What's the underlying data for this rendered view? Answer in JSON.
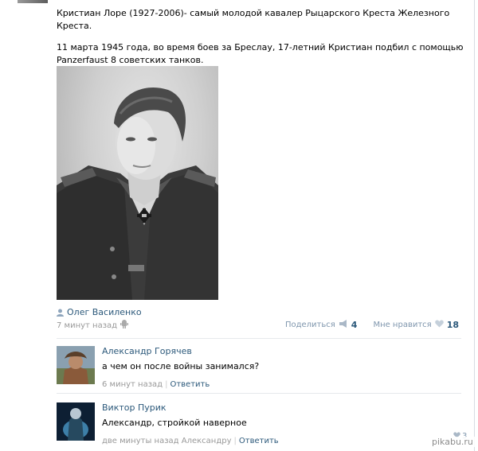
{
  "post": {
    "line1": "Кристиан Лоре (1927-2006)- самый молодой кавалер Рыцарского Креста Железного Креста.",
    "line2": "11 марта 1945 года, во время боев за Бреслау, 17-летний Кристиан подбил с помощью Panzerfaust 8 советских танков.",
    "author": "Олег Василенко",
    "time": "7 минут назад",
    "share_label": "Поделиться",
    "share_count": "4",
    "like_label": "Мне нравится",
    "like_count": "18"
  },
  "comments": [
    {
      "author": "Александр Горячев",
      "text": "а чем он после войны занимался?",
      "time": "6 минут назад",
      "reply_label": "Ответить"
    },
    {
      "author": "Виктор Пурик",
      "text": "Александр, стройкой наверное",
      "time": "две минуты назад Александру",
      "reply_label": "Ответить",
      "like_count": "3"
    }
  ],
  "watermark": "pikabu.ru",
  "colors": {
    "link": "#2b587a",
    "meta": "#999999",
    "accent": "#7f96ad"
  },
  "icons": {
    "author": "person-icon",
    "platform": "android-icon",
    "share": "megaphone-icon",
    "like": "heart-icon"
  }
}
